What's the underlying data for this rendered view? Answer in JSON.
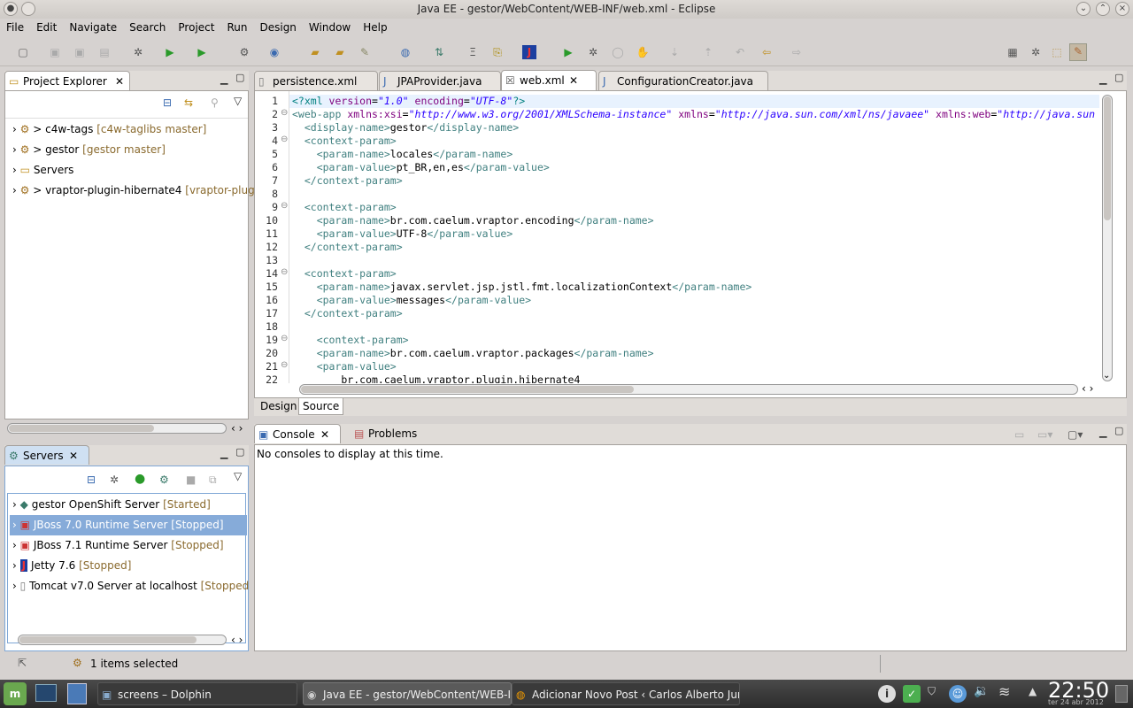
{
  "window": {
    "title": "Java EE - gestor/WebContent/WEB-INF/web.xml - Eclipse"
  },
  "menu": [
    "File",
    "Edit",
    "Navigate",
    "Search",
    "Project",
    "Run",
    "Design",
    "Window",
    "Help"
  ],
  "project_explorer": {
    "tab": "Project Explorer",
    "items": [
      {
        "name": "> c4w-tags",
        "deco": "[c4w-taglibs master]"
      },
      {
        "name": "> gestor",
        "deco": "[gestor master]"
      },
      {
        "name": "Servers",
        "deco": ""
      },
      {
        "name": "> vraptor-plugin-hibernate4",
        "deco": "[vraptor-plug"
      }
    ]
  },
  "servers": {
    "tab": "Servers",
    "items": [
      {
        "name": "gestor OpenShift Server",
        "status": "[Started]"
      },
      {
        "name": "JBoss 7.0 Runtime Server",
        "status": "[Stopped]"
      },
      {
        "name": "JBoss 7.1 Runtime Server",
        "status": "[Stopped]"
      },
      {
        "name": "Jetty 7.6",
        "status": "[Stopped]"
      },
      {
        "name": "Tomcat v7.0 Server at localhost",
        "status": "[Stopped"
      }
    ]
  },
  "editor": {
    "tabs": [
      "persistence.xml",
      "JPAProvider.java",
      "web.xml",
      "ConfigurationCreator.java"
    ],
    "bottom_tabs": [
      "Design",
      "Source"
    ]
  },
  "console": {
    "tabs": [
      "Console",
      "Problems"
    ],
    "message": "No consoles to display at this time."
  },
  "status": {
    "text": "1 items selected"
  },
  "taskbar": {
    "tasks": [
      "screens – Dolphin",
      "Java EE - gestor/WebContent/WEB-INF/",
      "Adicionar Novo Post ‹ Carlos Alberto Junior"
    ],
    "clock": "22:50",
    "date": "ter 24 abr 2012"
  }
}
